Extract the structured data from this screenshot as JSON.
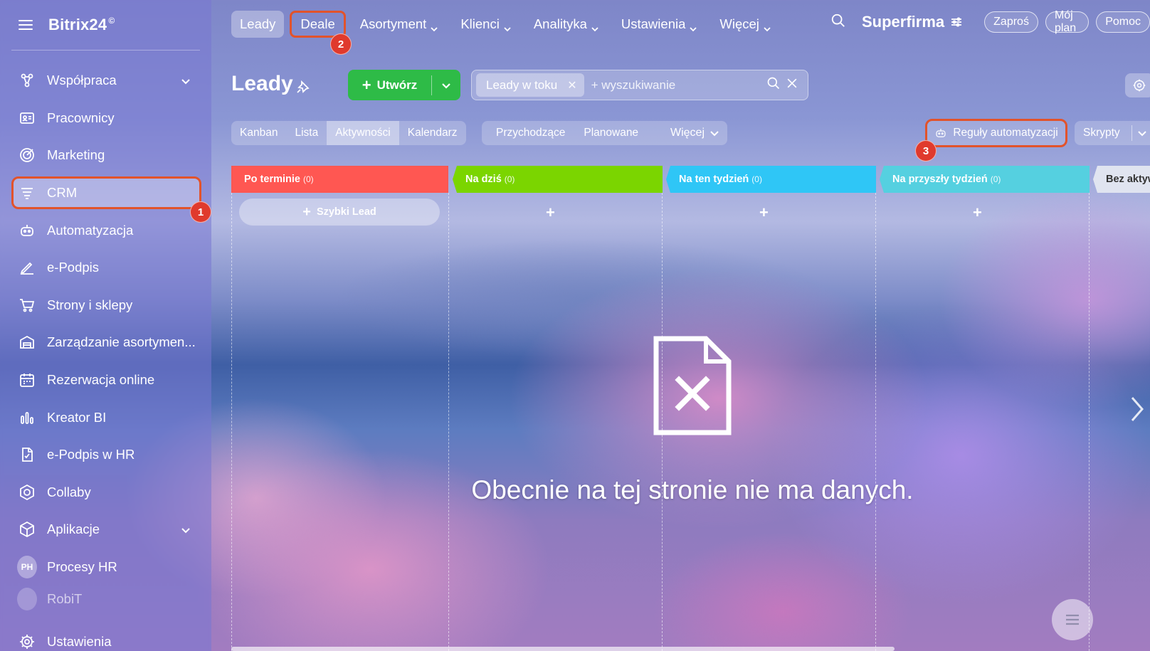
{
  "app": {
    "brand": "Bitrix24",
    "brand_mark": "©"
  },
  "sidebar": {
    "items": [
      {
        "label": "Współpraca",
        "icon": "collaboration-icon",
        "has_submenu": true
      },
      {
        "label": "Pracownicy",
        "icon": "employees-icon"
      },
      {
        "label": "Marketing",
        "icon": "marketing-icon"
      },
      {
        "label": "CRM",
        "icon": "crm-icon",
        "active": true
      },
      {
        "label": "Automatyzacja",
        "icon": "robot-icon"
      },
      {
        "label": "e-Podpis",
        "icon": "pen-icon"
      },
      {
        "label": "Strony i sklepy",
        "icon": "cart-icon"
      },
      {
        "label": "Zarządzanie asortymen...",
        "icon": "warehouse-icon"
      },
      {
        "label": "Rezerwacja online",
        "icon": "calendar-icon"
      },
      {
        "label": "Kreator BI",
        "icon": "bar-chart-icon"
      },
      {
        "label": "e-Podpis w HR",
        "icon": "hr-sign-icon"
      },
      {
        "label": "Collaby",
        "icon": "collaby-icon"
      },
      {
        "label": "Aplikacje",
        "icon": "apps-icon",
        "has_submenu": true
      },
      {
        "label": "Procesy HR",
        "icon": "ph-badge",
        "badge": "PH"
      },
      {
        "label": "RobiT",
        "icon": "badge-icon",
        "partial": true
      },
      {
        "label": "Ustawienia",
        "icon": "gear-icon"
      }
    ]
  },
  "topnav": {
    "tabs": [
      {
        "label": "Leady",
        "selected": true
      },
      {
        "label": "Deale"
      },
      {
        "label": "Asortyment",
        "dropdown": true
      },
      {
        "label": "Klienci",
        "dropdown": true
      },
      {
        "label": "Analityka",
        "dropdown": true
      },
      {
        "label": "Ustawienia",
        "dropdown": true
      },
      {
        "label": "Więcej",
        "dropdown": true
      }
    ],
    "company": "Superfirma",
    "buttons": [
      "Zaproś",
      "Mój plan",
      "Pomoc"
    ]
  },
  "header": {
    "title": "Leady",
    "create_label": "Utwórz",
    "filter_chip": "Leady w toku",
    "search_placeholder": "+ wyszukiwanie"
  },
  "views": {
    "items": [
      "Kanban",
      "Lista",
      "Aktywności",
      "Kalendarz"
    ],
    "selected": "Aktywności"
  },
  "counters": {
    "items": [
      "Przychodzące",
      "Planowane"
    ],
    "more": "Więcej"
  },
  "actions": {
    "automation": "Reguły automatyzacji",
    "scripts": "Skrypty"
  },
  "columns": [
    {
      "title": "Po terminie",
      "count": "(0)",
      "color": "#ff5752"
    },
    {
      "title": "Na dziś",
      "count": "(0)",
      "color": "#7bd500"
    },
    {
      "title": "Na ten tydzień",
      "count": "(0)",
      "color": "#2fc6f6"
    },
    {
      "title": "Na przyszły tydzień",
      "count": "(0)",
      "color": "#55d0e0"
    },
    {
      "title": "Bez aktyw",
      "count": "",
      "color": "#e0e4f0"
    }
  ],
  "quick_lead": "Szybki Lead",
  "add_symbol": "+",
  "empty_state": "Obecnie na tej stronie nie ma danych.",
  "callouts": [
    "1",
    "2",
    "3"
  ],
  "colors": {
    "accent_green": "#2ebb47",
    "highlight_outline": "#e2532b",
    "callout_red": "#e03a2d"
  }
}
